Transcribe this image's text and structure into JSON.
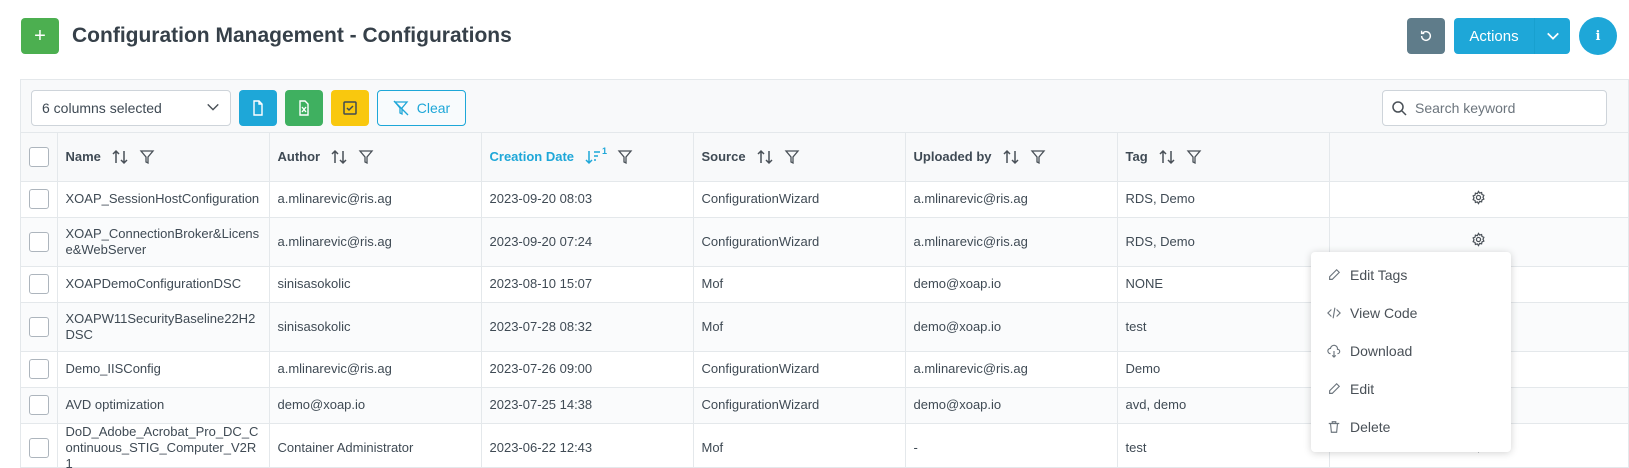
{
  "header": {
    "add_label": "+",
    "title": "Configuration Management - Configurations",
    "actions_label": "Actions",
    "info_label": "i"
  },
  "toolbar": {
    "columns_selected": "6 columns selected",
    "clear_label": "Clear",
    "search_placeholder": "Search keyword"
  },
  "table": {
    "columns": [
      {
        "label": "Name",
        "sort": "none"
      },
      {
        "label": "Author",
        "sort": "none"
      },
      {
        "label": "Creation Date",
        "sort": "desc",
        "sort_order": "1"
      },
      {
        "label": "Source",
        "sort": "none"
      },
      {
        "label": "Uploaded by",
        "sort": "none"
      },
      {
        "label": "Tag",
        "sort": "none"
      }
    ],
    "rows": [
      {
        "name": "XOAP_SessionHostConfiguration",
        "author": "a.mlinarevic@ris.ag",
        "date": "2023-09-20 08:03",
        "source": "ConfigurationWizard",
        "uploaded_by": "a.mlinarevic@ris.ag",
        "tag": "RDS, Demo"
      },
      {
        "name": "XOAP_ConnectionBroker&License&WebServer",
        "author": "a.mlinarevic@ris.ag",
        "date": "2023-09-20 07:24",
        "source": "ConfigurationWizard",
        "uploaded_by": "a.mlinarevic@ris.ag",
        "tag": "RDS, Demo"
      },
      {
        "name": "XOAPDemoConfigurationDSC",
        "author": "sinisasokolic",
        "date": "2023-08-10 15:07",
        "source": "Mof",
        "uploaded_by": "demo@xoap.io",
        "tag": "NONE"
      },
      {
        "name": "XOAPW11SecurityBaseline22H2DSC",
        "author": "sinisasokolic",
        "date": "2023-07-28 08:32",
        "source": "Mof",
        "uploaded_by": "demo@xoap.io",
        "tag": "test"
      },
      {
        "name": "Demo_IISConfig",
        "author": "a.mlinarevic@ris.ag",
        "date": "2023-07-26 09:00",
        "source": "ConfigurationWizard",
        "uploaded_by": "a.mlinarevic@ris.ag",
        "tag": "Demo"
      },
      {
        "name": "AVD optimization",
        "author": "demo@xoap.io",
        "date": "2023-07-25 14:38",
        "source": "ConfigurationWizard",
        "uploaded_by": "demo@xoap.io",
        "tag": "avd, demo"
      },
      {
        "name": "DoD_Adobe_Acrobat_Pro_DC_Continuous_STIG_Computer_V2R1",
        "author": "Container Administrator",
        "date": "2023-06-22 12:43",
        "source": "Mof",
        "uploaded_by": "-",
        "tag": "test"
      }
    ]
  },
  "context_menu": {
    "items": [
      {
        "label": "Edit Tags",
        "icon": "pencil-icon"
      },
      {
        "label": "View Code",
        "icon": "code-icon"
      },
      {
        "label": "Download",
        "icon": "cloud-download-icon"
      },
      {
        "label": "Edit",
        "icon": "pencil-icon"
      },
      {
        "label": "Delete",
        "icon": "trash-icon"
      }
    ]
  },
  "colors": {
    "green": "#4caf50",
    "blue": "#1ea7d8",
    "slate": "#5f7c8a",
    "yellow": "#f9c80e",
    "excel_green": "#3fb060"
  }
}
